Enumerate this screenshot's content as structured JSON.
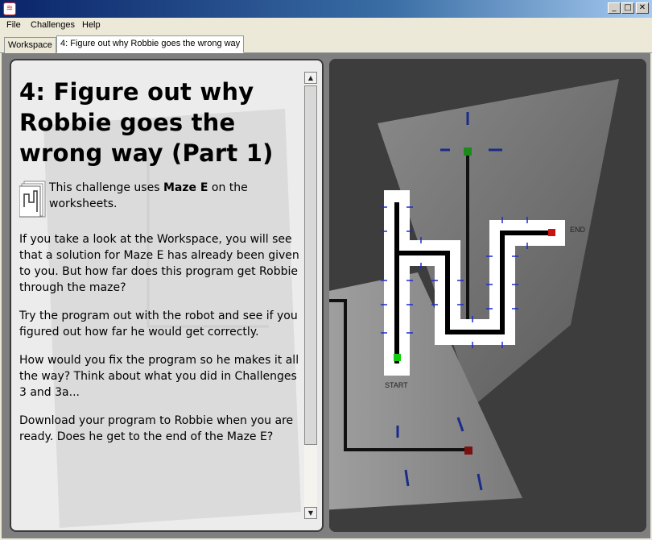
{
  "window": {
    "icon_glyph": "≋",
    "controls": {
      "minimize": "_",
      "maximize": "□",
      "close": "✕"
    }
  },
  "menu": [
    "File",
    "Challenges",
    "Help"
  ],
  "tabs": [
    {
      "label": "Workspace",
      "active": false
    },
    {
      "label": "4: Figure out why Robbie goes the wrong way",
      "active": true
    }
  ],
  "challenge": {
    "title": "4: Figure out why Robbie goes the wrong way (Part 1)",
    "intro_prefix": "This challenge uses ",
    "intro_bold": "Maze E",
    "intro_suffix": " on the worksheets.",
    "paragraphs": [
      "If you take a look at the Workspace, you will see that a solution for Maze E has already been given to you. But how far does this program get Robbie through the maze?",
      "Try the program out with the robot and see if you figured out how far he would get correctly.",
      "How would you fix the program so he makes it all the way? Think about what you did in Challenges 3 and 3a...",
      "Download your program to Robbie when you are ready. Does he get to the end of the Maze E?"
    ]
  },
  "maze": {
    "start_label": "START",
    "end_label": "END",
    "colors": {
      "start": "#11cc11",
      "end": "#cc1111",
      "path": "#000000",
      "track": "#ffffff",
      "tick": "#1a2bd0"
    }
  },
  "scrollbar": {
    "up_glyph": "▲",
    "down_glyph": "▼"
  }
}
